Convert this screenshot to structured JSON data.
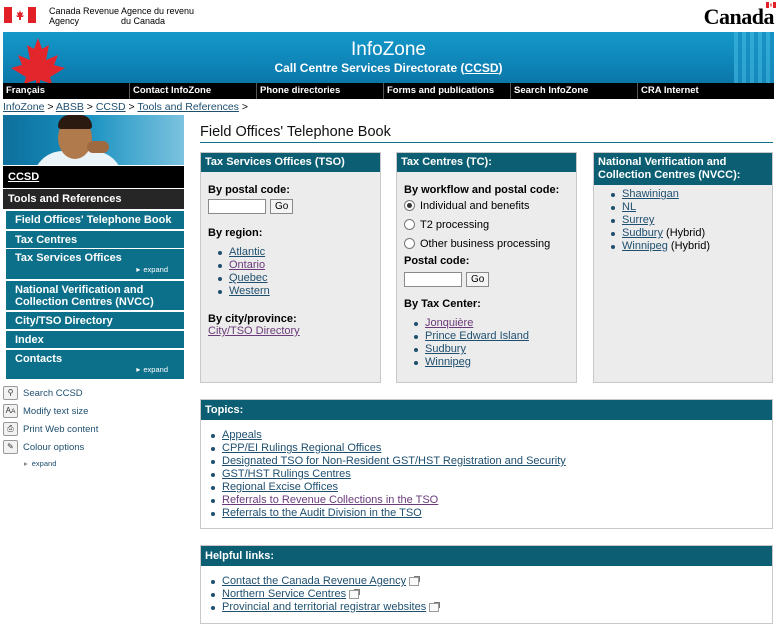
{
  "fip": {
    "dept_en": "Canada Revenue\nAgency",
    "dept_fr": "Agence du revenu\ndu Canada",
    "wordmark": "Canada"
  },
  "banner": {
    "title": "InfoZone",
    "subtitle_prefix": "Call Centre Services Directorate (",
    "subtitle_link": "CCSD",
    "subtitle_suffix": ")"
  },
  "topnav": [
    "Français",
    "Contact InfoZone",
    "Phone directories",
    "Forms and publications",
    "Search InfoZone",
    "CRA Internet"
  ],
  "breadcrumb": [
    "InfoZone",
    "ABSB",
    "CCSD",
    "Tools and References"
  ],
  "sidebar": {
    "ccsd": "CCSD",
    "tools": "Tools and References",
    "items": [
      {
        "label": "Field Offices' Telephone Book",
        "expand": ""
      },
      {
        "label": "Tax Centres",
        "expand": ""
      },
      {
        "label": "Tax Services Offices",
        "expand": "expand"
      },
      {
        "label": "National Verification and Collection Centres (NVCC)",
        "expand": ""
      },
      {
        "label": "City/TSO Directory",
        "expand": ""
      },
      {
        "label": "Index",
        "expand": ""
      },
      {
        "label": "Contacts",
        "expand": "expand"
      }
    ],
    "tools_links": [
      "Search CCSD",
      "Modify text size",
      "Print Web content",
      "Colour options"
    ],
    "tools_expand": "expand"
  },
  "main": {
    "title": "Field Offices' Telephone Book",
    "tso": {
      "header": "Tax Services Offices (TSO)",
      "postal_label": "By postal code:",
      "go": "Go",
      "region_label": "By region:",
      "regions": [
        "Atlantic",
        "Ontario",
        "Quebec",
        "Western"
      ],
      "city_label": "By city/province:",
      "city_link": "City/TSO Directory"
    },
    "tc": {
      "header": "Tax Centres (TC):",
      "workflow_label": "By workflow and postal code:",
      "options": [
        "Individual and benefits",
        "T2 processing",
        "Other business processing"
      ],
      "selected_option": "Individual and benefits",
      "postal_label": "Postal code:",
      "go": "Go",
      "center_label": "By Tax Center:",
      "centers": [
        "Jonquière",
        "Prince Edward Island",
        "Sudbury",
        "Winnipeg"
      ]
    },
    "nvcc": {
      "header": "National Verification and Collection Centres (NVCC):",
      "items": [
        {
          "link": "Shawinigan",
          "note": ""
        },
        {
          "link": "NL",
          "note": ""
        },
        {
          "link": "Surrey",
          "note": ""
        },
        {
          "link": "Sudbury",
          "note": " (Hybrid)"
        },
        {
          "link": "Winnipeg",
          "note": " (Hybrid)"
        }
      ]
    },
    "topics": {
      "header": "Topics:",
      "items": [
        "Appeals",
        "CPP/EI Rulings Regional Offices",
        "Designated TSO for Non-Resident GST/HST Registration and Security",
        "GST/HST Rulings Centres",
        "Regional Excise Offices",
        "Referrals to Revenue Collections in the TSO",
        "Referrals to the Audit Division in the TSO"
      ]
    },
    "helpful": {
      "header": "Helpful links:",
      "items": [
        "Contact the Canada Revenue Agency",
        "Northern Service Centres",
        "Provincial and territorial registrar websites"
      ]
    }
  },
  "colors": {
    "accent": "#0c708a",
    "header_dark": "#0c5f73",
    "banner": "#1599c9",
    "link": "#1f4f6f",
    "visited": "#6a3a7a"
  }
}
